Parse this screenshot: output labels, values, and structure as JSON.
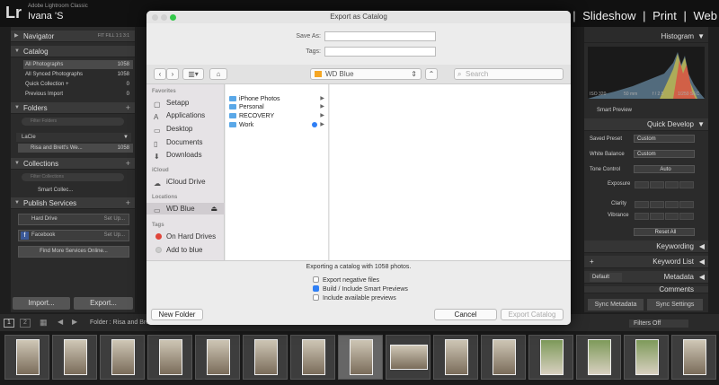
{
  "app": {
    "logo": "Lr",
    "name": "Adobe Lightroom Classic",
    "user": "Ivana 'S",
    "modules": [
      "|",
      "Slideshow",
      "|",
      "Print",
      "|",
      "Web"
    ]
  },
  "left": {
    "navigator": "Navigator",
    "nav_modes": "FIT  FILL  1:1  3:1",
    "catalog": "Catalog",
    "catalog_items": [
      {
        "label": "All Photographs",
        "count": "1058"
      },
      {
        "label": "All Synced Photographs",
        "count": "1058"
      },
      {
        "label": "Quick Collection +",
        "count": "0"
      },
      {
        "label": "Previous Import",
        "count": "0"
      }
    ],
    "folders": "Folders",
    "folder_filter": "Filter Folders",
    "volume": "LaCie",
    "folder_item": {
      "label": "Risa and Brett's We...",
      "count": "1058"
    },
    "collections": "Collections",
    "collection_filter": "Filter Collections",
    "smart_collections": "Smart Collec...",
    "publish": "Publish Services",
    "services": [
      {
        "label": "Hard Drive",
        "setup": "Set Up..."
      },
      {
        "label": "Facebook",
        "setup": "Set Up..."
      }
    ],
    "find_more": "Find More Services Online...",
    "import_btn": "Import...",
    "export_btn": "Export..."
  },
  "right": {
    "histogram": "Histogram",
    "hist_info": [
      "ISO 320",
      "50 mm",
      "f / 2.5",
      "1/250 SEC"
    ],
    "smart_preview": "Smart Preview",
    "quick_develop": "Quick Develop",
    "saved_preset": "Saved Preset",
    "saved_preset_val": "Custom",
    "white_balance": "White Balance",
    "white_balance_val": "Custom",
    "tone_control": "Tone Control",
    "auto": "Auto",
    "exposure": "Exposure",
    "clarity": "Clarity",
    "vibrance": "Vibrance",
    "reset": "Reset All",
    "keywording": "Keywording",
    "keyword_list": "Keyword List",
    "metadata": "Metadata",
    "metadata_preset": "Default",
    "comments": "Comments",
    "sync_metadata": "Sync Metadata",
    "sync_settings": "Sync Settings"
  },
  "filmbar": {
    "page1": "1",
    "page2": "2",
    "folder_label": "Folder : Risa and Bre",
    "filters_off": "Filters Off"
  },
  "thumbs": [
    "1",
    "2",
    "3",
    "4",
    "5",
    "6",
    "7",
    "8",
    "9",
    "10",
    "11",
    "12",
    "13",
    "14",
    "15"
  ],
  "dialog": {
    "title": "Export as Catalog",
    "save_as_label": "Save As:",
    "save_as_value": "",
    "tags_label": "Tags:",
    "tags_value": "",
    "location": "WD Blue",
    "search_placeholder": "Search",
    "favorites": "Favorites",
    "fav_items": [
      {
        "label": "Setapp",
        "icon": "app-icon"
      },
      {
        "label": "Applications",
        "icon": "applications-icon"
      },
      {
        "label": "Desktop",
        "icon": "desktop-icon"
      },
      {
        "label": "Documents",
        "icon": "documents-icon"
      },
      {
        "label": "Downloads",
        "icon": "downloads-icon"
      }
    ],
    "icloud": "iCloud",
    "icloud_drive": "iCloud Drive",
    "locations": "Locations",
    "wd_blue": "WD Blue",
    "tags_section": "Tags",
    "tag_items": [
      {
        "label": "On Hard Drives",
        "color": "#e0453a"
      },
      {
        "label": "Add to blue",
        "color": "#cccccc"
      }
    ],
    "files": [
      {
        "label": "iPhone Photos"
      },
      {
        "label": "Personal"
      },
      {
        "label": "RECOVERY"
      },
      {
        "label": "Work",
        "tag_color": "#2f7ff5"
      }
    ],
    "export_info": "Exporting a catalog with 1058 photos.",
    "options": [
      {
        "label": "Export negative files",
        "checked": false
      },
      {
        "label": "Build / Include Smart Previews",
        "checked": true
      },
      {
        "label": "Include available previews",
        "checked": false
      }
    ],
    "new_folder": "New Folder",
    "cancel": "Cancel",
    "export_catalog": "Export Catalog"
  },
  "colors": {
    "accent": "#2f7ff5",
    "close": "#fc605b",
    "min": "#fdbc40",
    "max": "#34c84a"
  }
}
